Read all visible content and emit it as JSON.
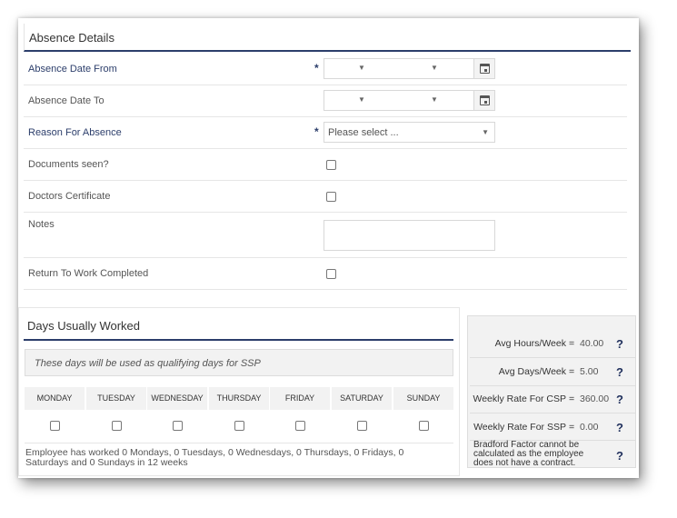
{
  "absence": {
    "title": "Absence Details",
    "fields": {
      "date_from": {
        "label": "Absence Date From",
        "required_mark": "*"
      },
      "date_to": {
        "label": "Absence Date To"
      },
      "reason": {
        "label": "Reason For Absence",
        "required_mark": "*",
        "value": "Please select ..."
      },
      "documents": {
        "label": "Documents seen?"
      },
      "doctors": {
        "label": "Doctors Certificate"
      },
      "notes": {
        "label": "Notes"
      },
      "rtw": {
        "label": "Return To Work Completed"
      }
    }
  },
  "days": {
    "title": "Days Usually Worked",
    "note": "These days will be used as qualifying days for SSP",
    "weekdays": [
      "MONDAY",
      "TUESDAY",
      "WEDNESDAY",
      "THURSDAY",
      "FRIDAY",
      "SATURDAY",
      "SUNDAY"
    ],
    "summary": "Employee has worked 0 Mondays, 0 Tuesdays, 0 Wednesdays, 0 Thursdays, 0 Fridays, 0 Saturdays and 0 Sundays in 12 weeks"
  },
  "stats": {
    "avg_hours": {
      "label": "Avg Hours/Week",
      "eq": "=",
      "value": "40.00",
      "help": "?"
    },
    "avg_days": {
      "label": "Avg Days/Week",
      "eq": "=",
      "value": "5.00",
      "help": "?"
    },
    "csp": {
      "label": "Weekly Rate For CSP",
      "eq": "=",
      "value": "360.00",
      "help": "?"
    },
    "ssp": {
      "label": "Weekly Rate For SSP",
      "eq": "=",
      "value": "0.00",
      "help": "?"
    },
    "bradford": {
      "text": "Bradford Factor cannot be calculated as the employee does not have a contract.",
      "help": "?"
    }
  },
  "icons": {
    "dropdown": "▼"
  }
}
